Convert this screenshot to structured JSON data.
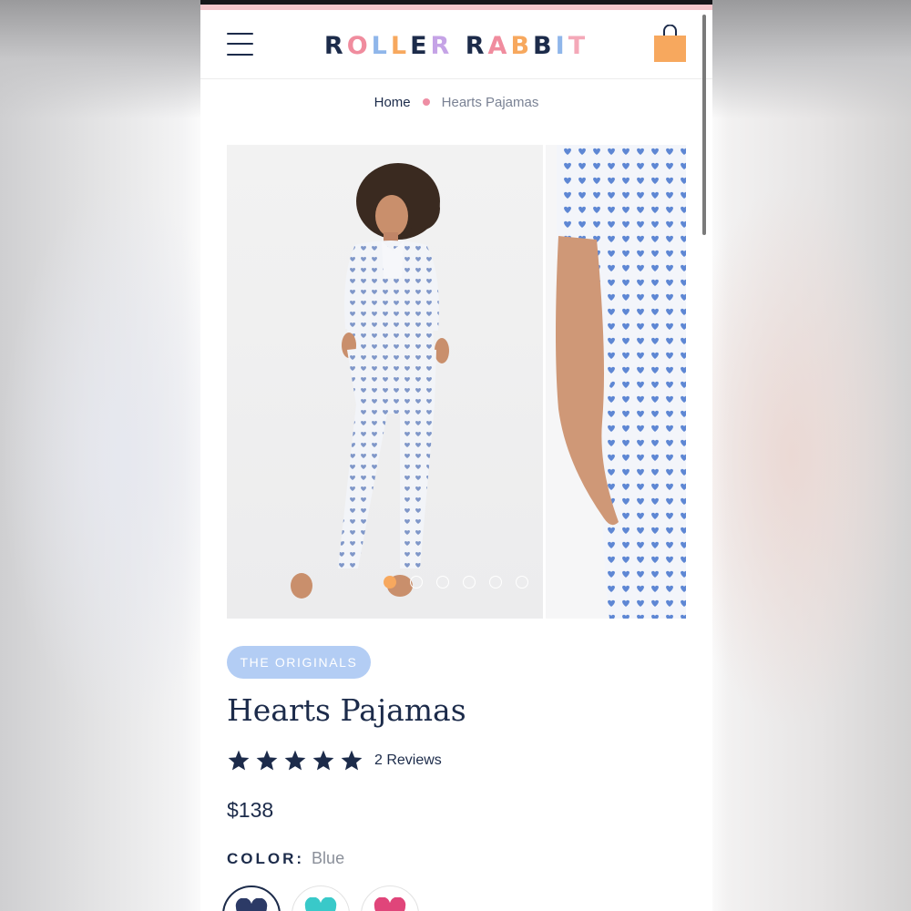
{
  "brand": {
    "logo_letters": [
      {
        "ch": "R",
        "color": "#1c2b4a"
      },
      {
        "ch": "O",
        "color": "#f08c9e"
      },
      {
        "ch": "L",
        "color": "#8fb6ea"
      },
      {
        "ch": "L",
        "color": "#f7a85e"
      },
      {
        "ch": "E",
        "color": "#1c2b4a"
      },
      {
        "ch": "R",
        "color": "#c5a3e6"
      },
      {
        "ch": " ",
        "color": "#ffffff"
      },
      {
        "ch": "R",
        "color": "#1c2b4a"
      },
      {
        "ch": "A",
        "color": "#f08c9e"
      },
      {
        "ch": "B",
        "color": "#f7a85e"
      },
      {
        "ch": "B",
        "color": "#1c2b4a"
      },
      {
        "ch": "I",
        "color": "#8fb6ea"
      },
      {
        "ch": "T",
        "color": "#f4a8b8"
      }
    ],
    "logo_text": "ROLLER RABBIT",
    "accent_orange": "#f7a85e",
    "navy": "#1c2b4a"
  },
  "header": {
    "menu_icon": "hamburger-menu-icon",
    "cart_icon": "shopping-bag-icon"
  },
  "breadcrumb": {
    "home": "Home",
    "current": "Hearts Pajamas"
  },
  "gallery": {
    "slide_count": 6,
    "active_index": 0
  },
  "product": {
    "badge": "THE ORIGINALS",
    "title": "Hearts Pajamas",
    "rating": 5,
    "reviews_label": "2 Reviews",
    "price": "$138",
    "color_label": "COLOR:",
    "color_value": "Blue",
    "swatches": [
      {
        "name": "Blue",
        "color": "#2c3a66",
        "selected": true
      },
      {
        "name": "Aqua",
        "color": "#39c9c9",
        "selected": false
      },
      {
        "name": "Pink",
        "color": "#e0457a",
        "selected": false
      }
    ]
  }
}
